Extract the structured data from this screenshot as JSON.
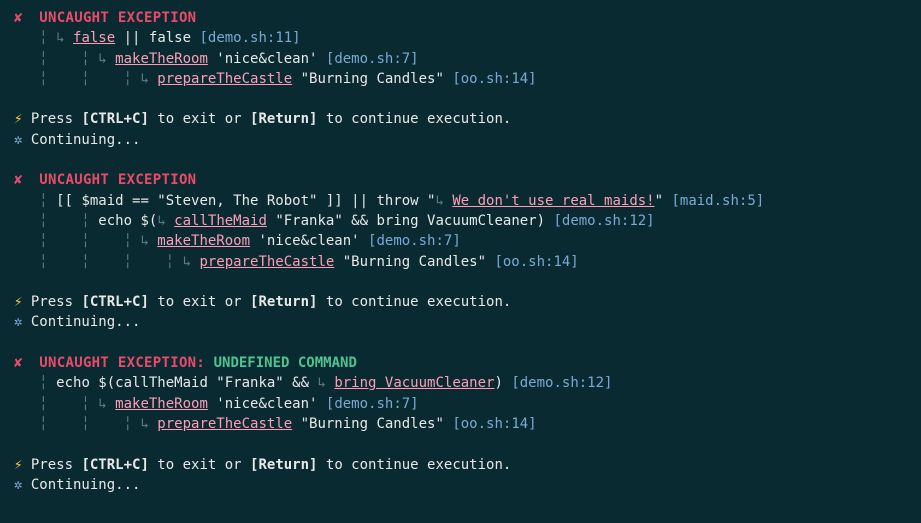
{
  "blocks": [
    {
      "header": "UNCAUGHT EXCEPTION",
      "subheader": "",
      "frames": [
        {
          "indent": 0,
          "pre": "",
          "arrow": true,
          "ul": "false",
          "mid": " || false ",
          "loc": "[demo.sh:11]"
        },
        {
          "indent": 1,
          "pre": "",
          "arrow": true,
          "ul": "makeTheRoom",
          "mid": " 'nice&clean' ",
          "loc": "[demo.sh:7]"
        },
        {
          "indent": 2,
          "pre": "",
          "arrow": true,
          "ul": "prepareTheCastle",
          "mid": " \"Burning Candles\" ",
          "loc": "[oo.sh:14]"
        }
      ]
    },
    {
      "header": "UNCAUGHT EXCEPTION",
      "subheader": "",
      "frames": [
        {
          "indent": 0,
          "pre": "[[ $maid == \"Steven, The Robot\" ]] || throw \"",
          "arrow": true,
          "ul": "We don't use real maids!",
          "mid": "\" ",
          "loc": "[maid.sh:5]"
        },
        {
          "indent": 1,
          "pre": "echo $(",
          "arrow": true,
          "ul": "callTheMaid",
          "mid": " \"Franka\" && bring VacuumCleaner) ",
          "loc": "[demo.sh:12]"
        },
        {
          "indent": 2,
          "pre": "",
          "arrow": true,
          "ul": "makeTheRoom",
          "mid": " 'nice&clean' ",
          "loc": "[demo.sh:7]"
        },
        {
          "indent": 3,
          "pre": "",
          "arrow": true,
          "ul": "prepareTheCastle",
          "mid": " \"Burning Candles\" ",
          "loc": "[oo.sh:14]"
        }
      ]
    },
    {
      "header": "UNCAUGHT EXCEPTION:",
      "subheader": " UNDEFINED COMMAND",
      "frames": [
        {
          "indent": 0,
          "pre": "echo $(callTheMaid \"Franka\" && ",
          "arrow": true,
          "ul": "bring VacuumCleaner",
          "mid": ") ",
          "loc": "[demo.sh:12]"
        },
        {
          "indent": 1,
          "pre": "",
          "arrow": true,
          "ul": "makeTheRoom",
          "mid": " 'nice&clean' ",
          "loc": "[demo.sh:7]"
        },
        {
          "indent": 2,
          "pre": "",
          "arrow": true,
          "ul": "prepareTheCastle",
          "mid": " \"Burning Candles\" ",
          "loc": "[oo.sh:14]"
        }
      ]
    }
  ],
  "prompt": {
    "a": "Press ",
    "b": "[CTRL+C]",
    "c": " to exit or ",
    "d": "[Return]",
    "e": " to continue execution."
  },
  "cont": "Continuing...",
  "glyph": {
    "x": "✘",
    "bolt": "⚡",
    "gear": "✲",
    "arrow": "↳",
    "tree": "╎"
  }
}
